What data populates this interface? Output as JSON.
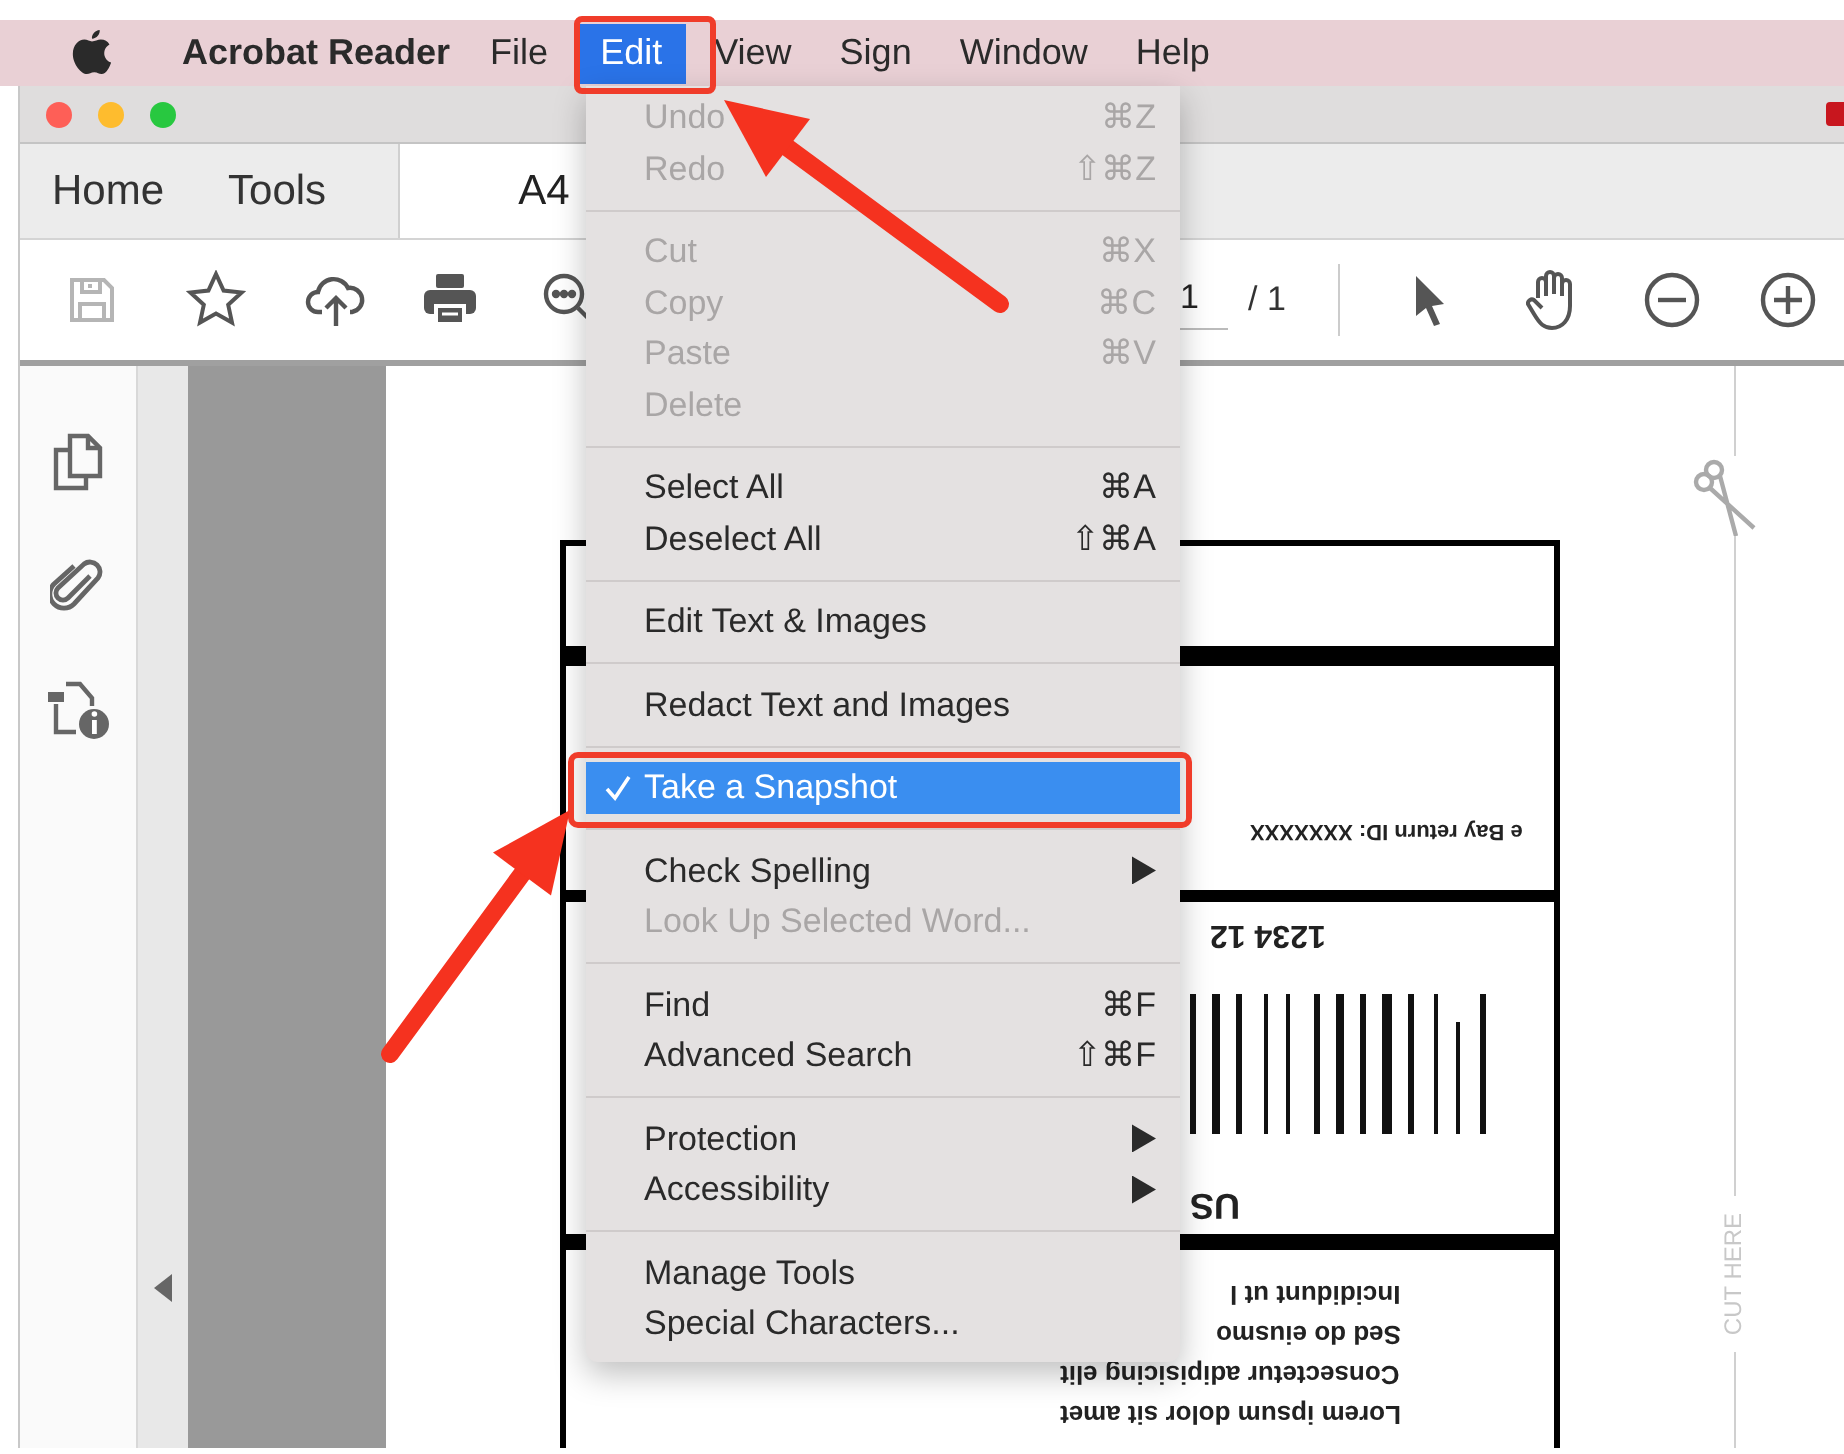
{
  "menu_bar": {
    "items": [
      {
        "label": "Acrobat Reader",
        "kind": "app",
        "selected": false
      },
      {
        "label": "File",
        "kind": "menu",
        "selected": false
      },
      {
        "label": "Edit",
        "kind": "menu",
        "selected": true
      },
      {
        "label": "View",
        "kind": "menu",
        "selected": false
      },
      {
        "label": "Sign",
        "kind": "menu",
        "selected": false
      },
      {
        "label": "Window",
        "kind": "menu",
        "selected": false
      },
      {
        "label": "Help",
        "kind": "menu",
        "selected": false
      }
    ]
  },
  "tabs": [
    {
      "label": "Home",
      "selected": false
    },
    {
      "label": "Tools",
      "selected": false
    },
    {
      "label": "A4",
      "selected": true
    }
  ],
  "toolbar": {
    "page_number": "1",
    "page_total": "/ 1"
  },
  "document": {
    "return_id": "e Bay return ID: XXXXXXX",
    "code": "1234 12",
    "country": "US",
    "address_lines": [
      "Incididunt ut l",
      "Sed do eiusmo",
      "Consectetur adipisicing elit",
      "Lorem ipsum dolor sit amet"
    ],
    "cut_label": "CUT HERE"
  },
  "edit_menu": {
    "sections": [
      [
        {
          "label": "Undo",
          "shortcut": "⌘Z",
          "disabled": true,
          "selected": false,
          "checked": false,
          "submenu": false
        },
        {
          "label": "Redo",
          "shortcut": "⇧⌘Z",
          "disabled": true,
          "selected": false,
          "checked": false,
          "submenu": false
        }
      ],
      [
        {
          "label": "Cut",
          "shortcut": "⌘X",
          "disabled": true,
          "selected": false,
          "checked": false,
          "submenu": false
        },
        {
          "label": "Copy",
          "shortcut": "⌘C",
          "disabled": true,
          "selected": false,
          "checked": false,
          "submenu": false
        },
        {
          "label": "Paste",
          "shortcut": "⌘V",
          "disabled": true,
          "selected": false,
          "checked": false,
          "submenu": false
        },
        {
          "label": "Delete",
          "disabled": true,
          "selected": false,
          "checked": false,
          "submenu": false
        }
      ],
      [
        {
          "label": "Select All",
          "shortcut": "⌘A",
          "disabled": false,
          "selected": false,
          "checked": false,
          "submenu": false
        },
        {
          "label": "Deselect All",
          "shortcut": "⇧⌘A",
          "disabled": false,
          "selected": false,
          "checked": false,
          "submenu": false
        }
      ],
      [
        {
          "label": "Edit Text & Images",
          "disabled": false,
          "selected": false,
          "checked": false,
          "submenu": false
        }
      ],
      [
        {
          "label": "Redact Text and Images",
          "disabled": false,
          "selected": false,
          "checked": false,
          "submenu": false
        }
      ],
      [
        {
          "label": "Take a Snapshot",
          "disabled": false,
          "selected": true,
          "checked": true,
          "submenu": false
        }
      ],
      [
        {
          "label": "Check Spelling",
          "disabled": false,
          "selected": false,
          "checked": false,
          "submenu": true
        },
        {
          "label": "Look Up Selected Word...",
          "disabled": true,
          "selected": false,
          "checked": false,
          "submenu": false
        }
      ],
      [
        {
          "label": "Find",
          "shortcut": "⌘F",
          "disabled": false,
          "selected": false,
          "checked": false,
          "submenu": false
        },
        {
          "label": "Advanced Search",
          "shortcut": "⇧⌘F",
          "disabled": false,
          "selected": false,
          "checked": false,
          "submenu": false
        }
      ],
      [
        {
          "label": "Protection",
          "disabled": false,
          "selected": false,
          "checked": false,
          "submenu": true
        },
        {
          "label": "Accessibility",
          "disabled": false,
          "selected": false,
          "checked": false,
          "submenu": true
        }
      ],
      [
        {
          "label": "Manage Tools",
          "disabled": false,
          "selected": false,
          "checked": false,
          "submenu": false
        },
        {
          "label": "Special Characters...",
          "disabled": false,
          "selected": false,
          "checked": false,
          "submenu": false
        }
      ]
    ]
  }
}
